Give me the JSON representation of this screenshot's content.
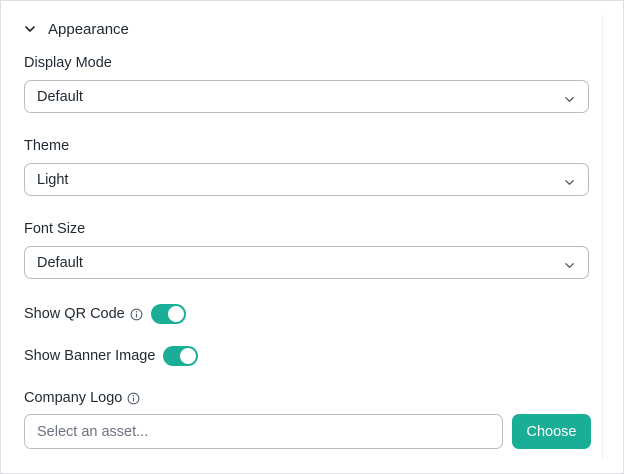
{
  "section": {
    "title": "Appearance",
    "expanded": true
  },
  "display_mode": {
    "label": "Display Mode",
    "value": "Default"
  },
  "theme": {
    "label": "Theme",
    "value": "Light"
  },
  "font_size": {
    "label": "Font Size",
    "value": "Default"
  },
  "show_qr_code": {
    "label": "Show QR Code",
    "enabled": true
  },
  "show_banner_image": {
    "label": "Show Banner Image",
    "enabled": true
  },
  "company_logo": {
    "label": "Company Logo",
    "placeholder": "Select an asset...",
    "value": "",
    "button_label": "Choose"
  },
  "colors": {
    "accent": "#1aae96",
    "border": "#b9bec6",
    "text": "#1f2933"
  },
  "icons": {
    "section_toggle": "chevron-down-icon",
    "select_arrow": "chevron-down-icon",
    "info": "info-icon"
  }
}
